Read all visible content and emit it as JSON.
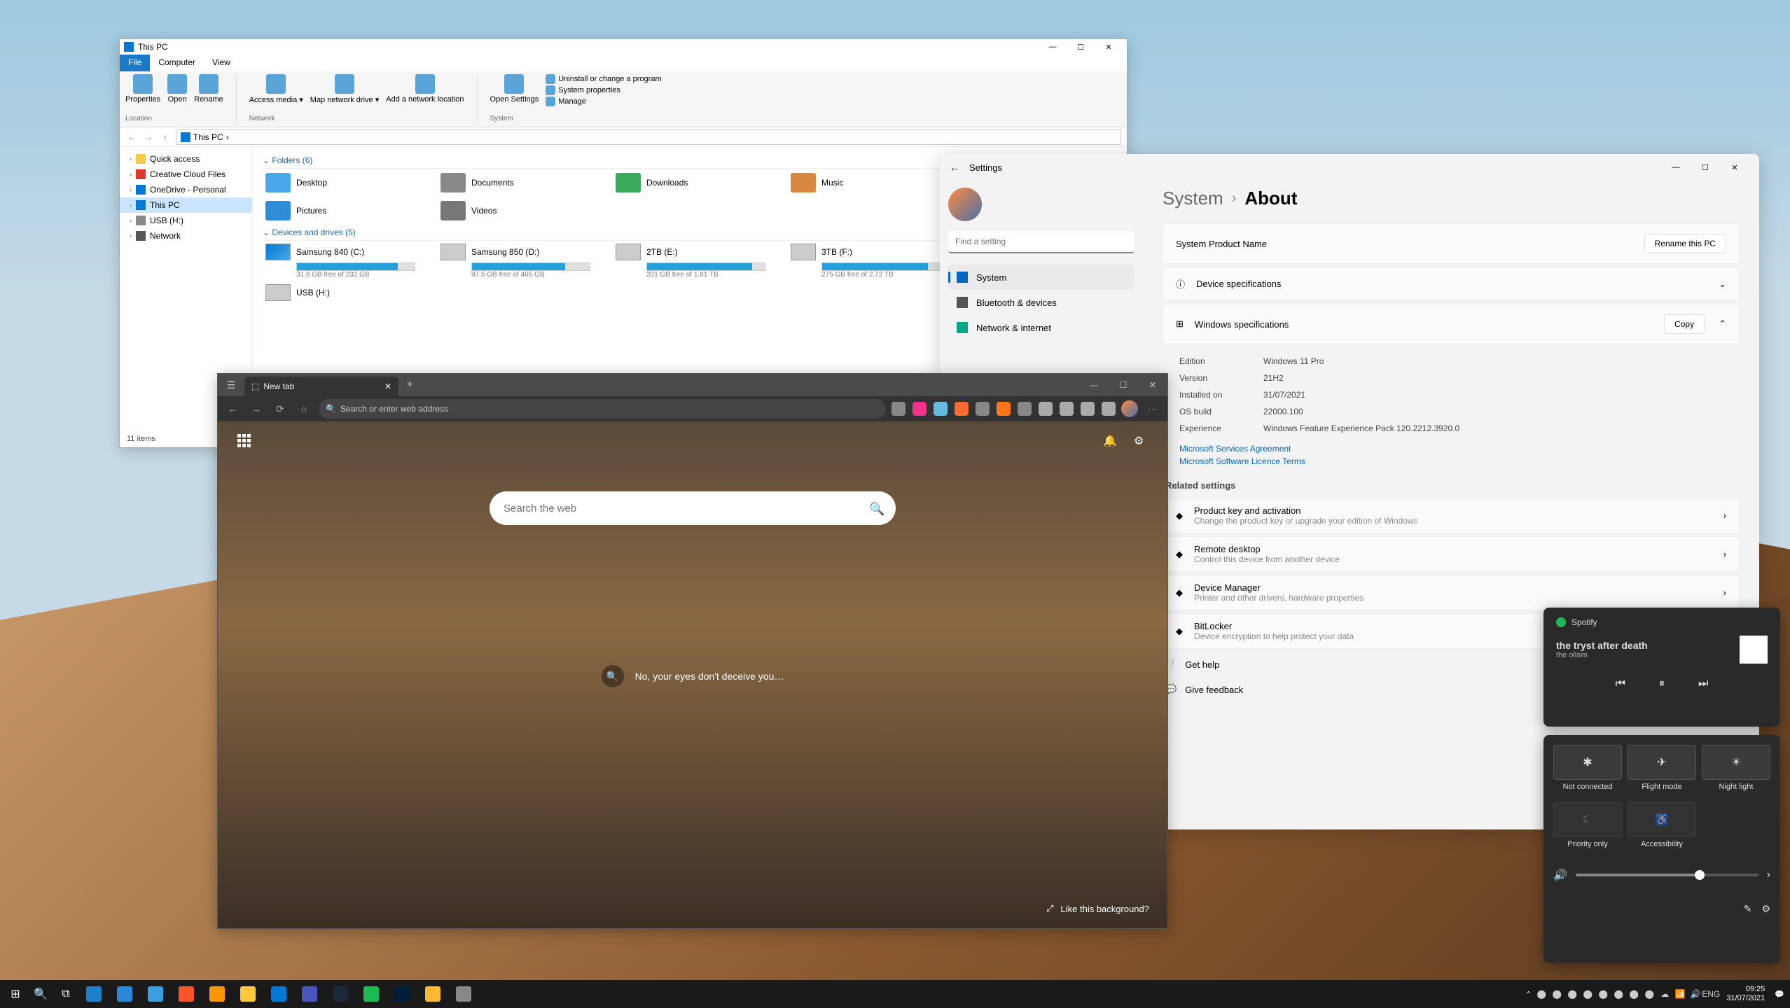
{
  "explorer": {
    "title": "This PC",
    "tabs": {
      "file": "File",
      "computer": "Computer",
      "view": "View"
    },
    "ribbon": {
      "properties": "Properties",
      "open": "Open",
      "rename": "Rename",
      "access_media": "Access media ▾",
      "map_drive": "Map network drive ▾",
      "add_location": "Add a network location",
      "open_settings": "Open Settings",
      "uninstall": "Uninstall or change a program",
      "sys_props": "System properties",
      "manage": "Manage",
      "grp_location": "Location",
      "grp_network": "Network",
      "grp_system": "System"
    },
    "breadcrumb": "This PC",
    "nav": {
      "quick": "Quick access",
      "ccf": "Creative Cloud Files",
      "onedrive": "OneDrive - Personal",
      "thispc": "This PC",
      "usb": "USB (H:)",
      "network": "Network"
    },
    "folders_hdr": "Folders (6)",
    "folders": [
      {
        "name": "Desktop",
        "cls": ""
      },
      {
        "name": "Documents",
        "cls": "doc"
      },
      {
        "name": "Downloads",
        "cls": "dl"
      },
      {
        "name": "Music",
        "cls": "mu"
      },
      {
        "name": "Pictures",
        "cls": "pi"
      },
      {
        "name": "Videos",
        "cls": "vi"
      }
    ],
    "drives_hdr": "Devices and drives (5)",
    "drives": [
      {
        "name": "Samsung 840 (C:)",
        "free": "31.9 GB free of 232 GB",
        "pct": 86,
        "win": true
      },
      {
        "name": "Samsung 850 (D:)",
        "free": "97.5 GB free of 465 GB",
        "pct": 79
      },
      {
        "name": "2TB (E:)",
        "free": "201 GB free of 1.81 TB",
        "pct": 89
      },
      {
        "name": "3TB (F:)",
        "free": "275 GB free of 2.72 TB",
        "pct": 90
      },
      {
        "name": "USB (H:)",
        "free": "",
        "pct": 0
      }
    ],
    "status": "11 items"
  },
  "edge": {
    "tab_title": "New tab",
    "omnibox_placeholder": "Search or enter web address",
    "search_placeholder": "Search the web",
    "trivia": "No, your eyes don't deceive you…",
    "bg_question": "Like this background?",
    "ext_colors": [
      "#888",
      "#e38",
      "#6bd",
      "#ff6b35",
      "#888",
      "#ff7518",
      "#888",
      "#aaa",
      "#aaa",
      "#aaa",
      "#aaa"
    ]
  },
  "settings": {
    "title": "Settings",
    "search_placeholder": "Find a setting",
    "nav": [
      "System",
      "Bluetooth & devices",
      "Network & internet"
    ],
    "bc_parent": "System",
    "bc_leaf": "About",
    "product": {
      "label": "System Product Name",
      "btn": "Rename this PC"
    },
    "dev_spec": "Device specifications",
    "win_spec": "Windows specifications",
    "copy": "Copy",
    "specs": [
      {
        "k": "Edition",
        "v": "Windows 11 Pro"
      },
      {
        "k": "Version",
        "v": "21H2"
      },
      {
        "k": "Installed on",
        "v": "31/07/2021"
      },
      {
        "k": "OS build",
        "v": "22000.100"
      },
      {
        "k": "Experience",
        "v": "Windows Feature Experience Pack 120.2212.3920.0"
      }
    ],
    "links": [
      "Microsoft Services Agreement",
      "Microsoft Software Licence Terms"
    ],
    "related_hdr": "Related settings",
    "related": [
      {
        "t": "Product key and activation",
        "s": "Change the product key or upgrade your edition of Windows"
      },
      {
        "t": "Remote desktop",
        "s": "Control this device from another device"
      },
      {
        "t": "Device Manager",
        "s": "Printer and other drivers, hardware properties"
      },
      {
        "t": "BitLocker",
        "s": "Device encryption to help protect your data"
      }
    ],
    "help": "Get help",
    "feedback": "Give feedback"
  },
  "media": {
    "source": "Spotify",
    "title": "the tryst after death",
    "artist": "the ollam"
  },
  "qs": {
    "tiles": [
      {
        "l": "Not connected",
        "g": "✱"
      },
      {
        "l": "Flight mode",
        "g": "✈"
      },
      {
        "l": "Night light",
        "g": "☀"
      },
      {
        "l": "Priority only",
        "g": "☾"
      },
      {
        "l": "Accessibility",
        "g": "♿"
      }
    ],
    "vol_pct": 68
  },
  "taskbar": {
    "apps": [
      {
        "name": "start",
        "c": "#0078d4"
      },
      {
        "name": "search",
        "c": ""
      },
      {
        "name": "taskview",
        "c": ""
      },
      {
        "name": "edge",
        "c": "#1e7fcb"
      },
      {
        "name": "edge-dev",
        "c": "#2b88d8"
      },
      {
        "name": "edge-canary",
        "c": "#3a9fde"
      },
      {
        "name": "brave",
        "c": "#fb542b"
      },
      {
        "name": "firefox",
        "c": "#ff9500"
      },
      {
        "name": "explorer",
        "c": "#ffc83d"
      },
      {
        "name": "outlook",
        "c": "#0078d4"
      },
      {
        "name": "teams",
        "c": "#4b53bc"
      },
      {
        "name": "steam",
        "c": "#1b2838"
      },
      {
        "name": "spotify",
        "c": "#1db954"
      },
      {
        "name": "photoshop",
        "c": "#001e36"
      },
      {
        "name": "notes",
        "c": "#fdb836"
      },
      {
        "name": "settings",
        "c": "#888"
      }
    ],
    "time": "09:25",
    "date": "31/07/2021"
  }
}
